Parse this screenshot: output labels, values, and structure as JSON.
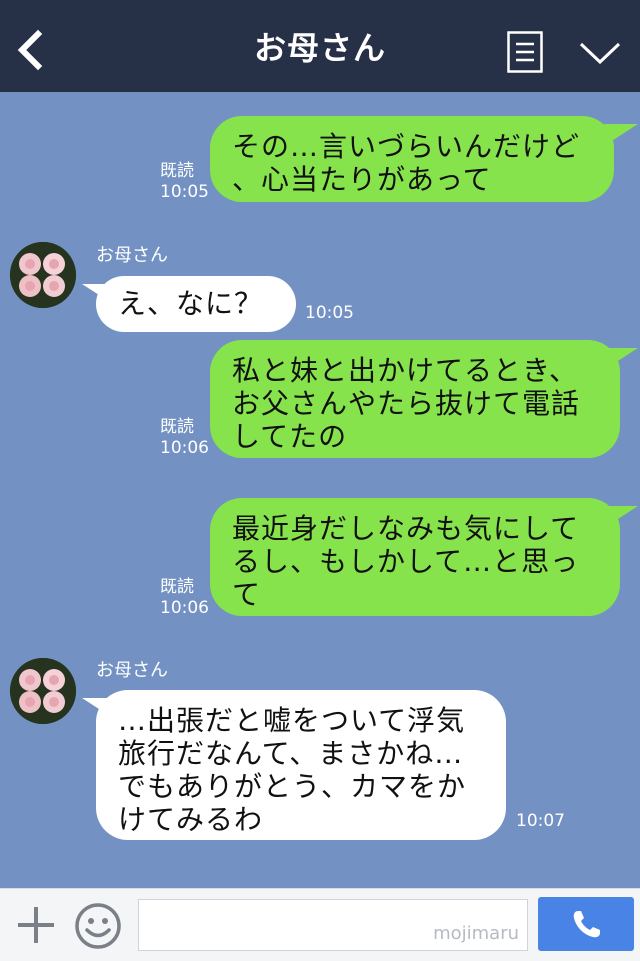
{
  "header": {
    "title": "お母さん",
    "back_icon": "chevron-left-icon",
    "menu_icon": "menu-icon",
    "collapse_icon": "chevron-down-icon"
  },
  "messages": [
    {
      "direction": "out",
      "lines": [
        "その…言いづらいんだけど",
        "、心当たりがあって"
      ],
      "read": "既読",
      "time": "10:05"
    },
    {
      "direction": "in",
      "sender": "お母さん",
      "lines": [
        "え、なに？"
      ],
      "time": "10:05"
    },
    {
      "direction": "out",
      "lines": [
        "私と妹と出かけてるとき、",
        "お父さんやたら抜けて電話",
        "してたの"
      ],
      "read": "既読",
      "time": "10:06"
    },
    {
      "direction": "out",
      "lines": [
        "最近身だしなみも気にして",
        "るし、もしかして…と思っ",
        "て"
      ],
      "read": "既読",
      "time": "10:06"
    },
    {
      "direction": "in",
      "sender": "お母さん",
      "lines": [
        "…出張だと嘘をついて浮気",
        "旅行だなんて、まさかね…",
        "でもありがとう、カマをか",
        "けてみるわ"
      ],
      "time": "10:07"
    }
  ],
  "footer": {
    "plus_icon": "plus-icon",
    "emoji_icon": "smile-icon",
    "input_value": "",
    "watermark": "mojimaru",
    "call_icon": "phone-icon"
  },
  "colors": {
    "background": "#7392c3",
    "header": "#263047",
    "outgoing_bubble": "#86e34b",
    "incoming_bubble": "#ffffff",
    "call_button": "#4a83e6"
  }
}
